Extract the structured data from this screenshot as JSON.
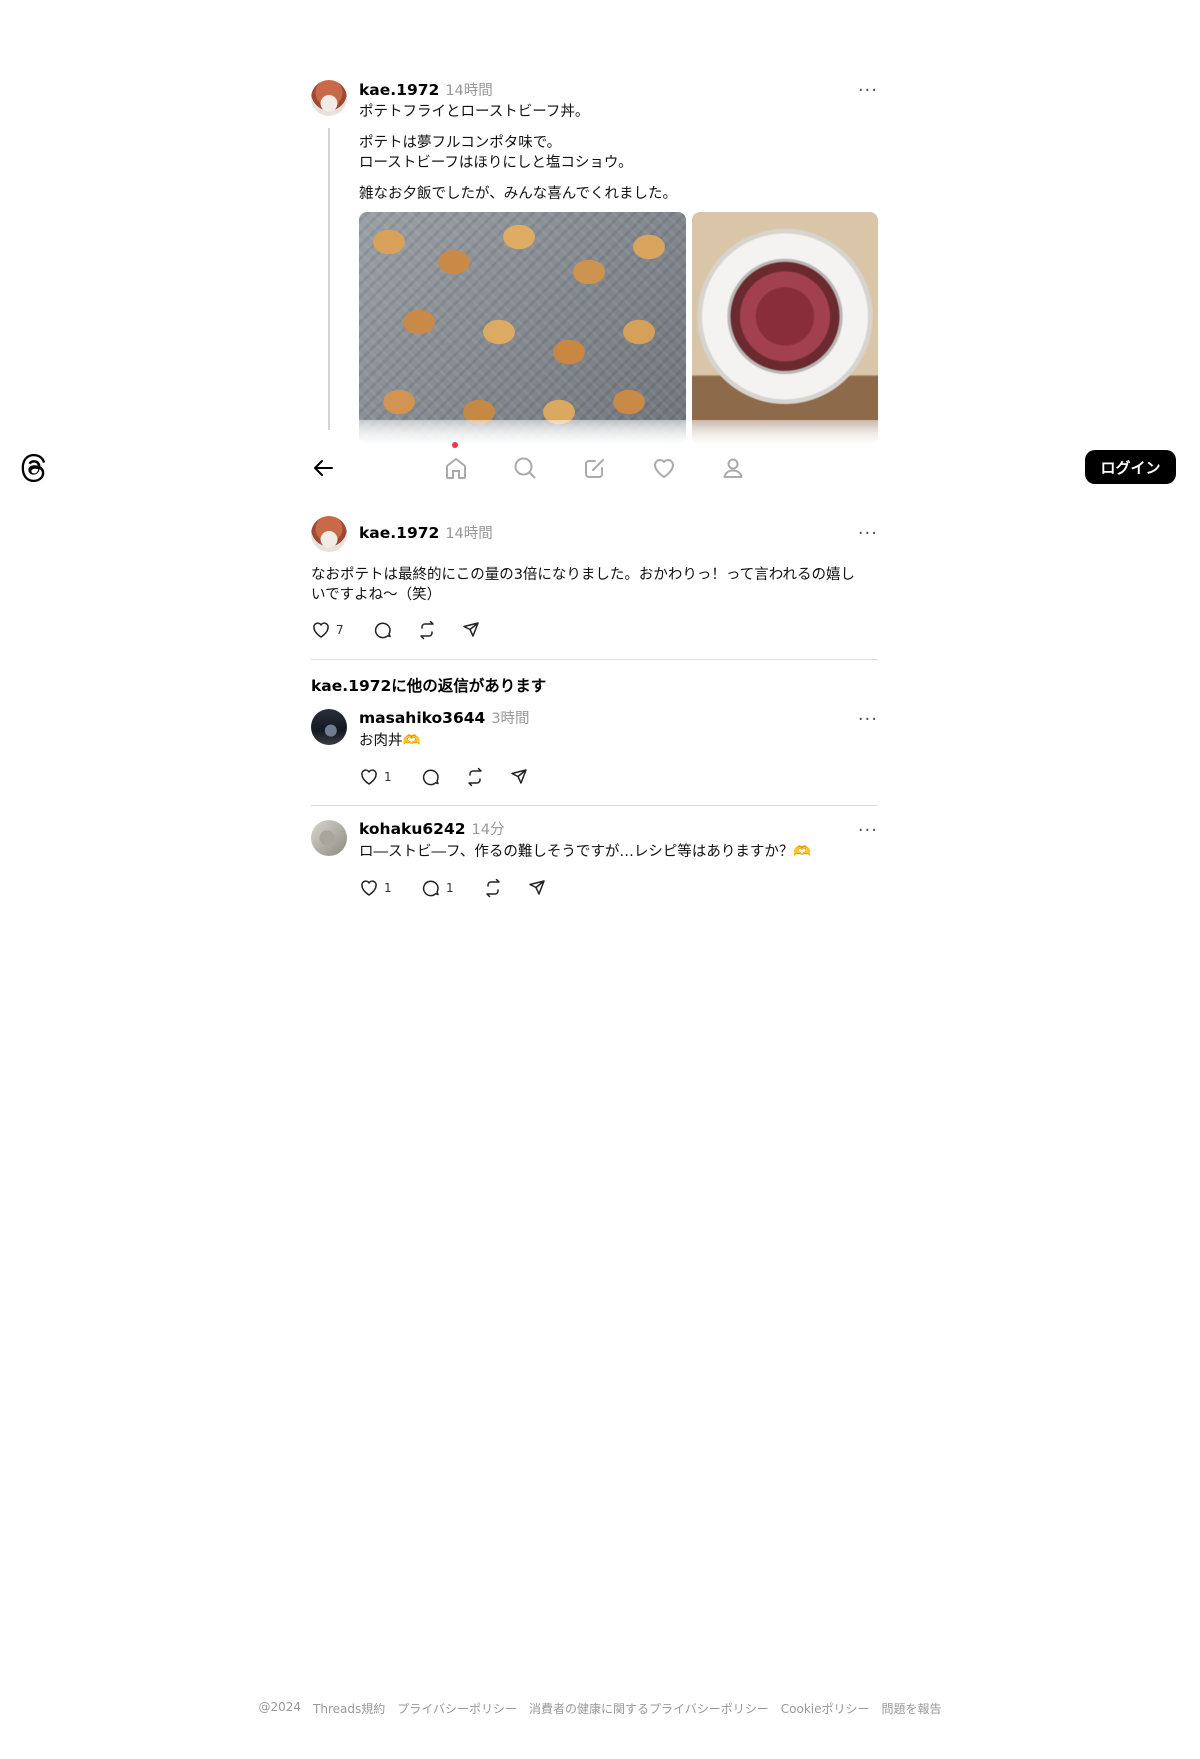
{
  "app": {
    "login_label": "ログイン"
  },
  "main_post": {
    "username": "kae.1972",
    "time": "14時間",
    "line1": "ポテトフライとローストビーフ丼。",
    "line2": "ポテトは夢フルコンポタ味で。",
    "line3": "ローストビーフはほりにしと塩コショウ。",
    "line4": "雑なお夕飯でしたが、みんな喜んでくれました。"
  },
  "reply_post": {
    "username": "kae.1972",
    "time": "14時間",
    "text_line1": "なおポテトは最終的にこの量の3倍になりました。おかわりっ！って言われるの嬉し",
    "text_line2": "いですよね〜（笑）",
    "like_count": "7"
  },
  "section_heading": "kae.1972に他の返信があります",
  "replies": [
    {
      "username": "masahiko3644",
      "time": "3時間",
      "text": "お肉丼🫶",
      "like_count": "1",
      "reply_count": ""
    },
    {
      "username": "kohaku6242",
      "time": "14分",
      "text": "ロ―ストビ―フ、作るの難しそうですが…レシピ等はありますか？🫶",
      "like_count": "1",
      "reply_count": "1"
    }
  ],
  "footer": {
    "copyright": "@2024",
    "terms": "Threads規約",
    "privacy": "プライバシーポリシー",
    "health_privacy": "消費者の健康に関するプライバシーポリシー",
    "cookie": "Cookieポリシー",
    "report": "問題を報告"
  },
  "colors": {
    "accent_dot": "#ff3040",
    "login_bg": "#000000"
  },
  "icons": [
    "threads-logo-icon",
    "back-arrow-icon",
    "home-icon",
    "search-icon",
    "compose-icon",
    "heart-icon",
    "profile-icon",
    "like-icon",
    "comment-icon",
    "repost-icon",
    "share-icon",
    "more-icon"
  ]
}
